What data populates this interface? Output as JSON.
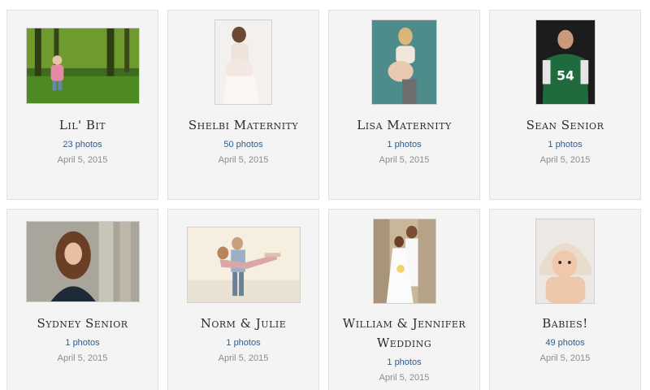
{
  "galleries": [
    {
      "title": "Lil' Bit",
      "count": "23 photos",
      "date": "April 5, 2015",
      "image": "child-in-forest-photo"
    },
    {
      "title": "Shelbi Maternity",
      "count": "50 photos",
      "date": "April 5, 2015",
      "image": "maternity-portrait-photo"
    },
    {
      "title": "Lisa Maternity",
      "count": "1 photos",
      "date": "April 5, 2015",
      "image": "maternity-portrait-photo"
    },
    {
      "title": "Sean Senior",
      "count": "1 photos",
      "date": "April 5, 2015",
      "image": "senior-portrait-photo"
    },
    {
      "title": "Sydney Senior",
      "count": "1 photos",
      "date": "April 5, 2015",
      "image": "senior-portrait-photo"
    },
    {
      "title": "Norm & Julie",
      "count": "1 photos",
      "date": "April 5, 2015",
      "image": "couple-photo"
    },
    {
      "title": "William & Jennifer Wedding",
      "count": "1 photos",
      "date": "April 5, 2015",
      "image": "wedding-photo"
    },
    {
      "title": "Babies!",
      "count": "49 photos",
      "date": "April 5, 2015",
      "image": "baby-photo"
    }
  ]
}
